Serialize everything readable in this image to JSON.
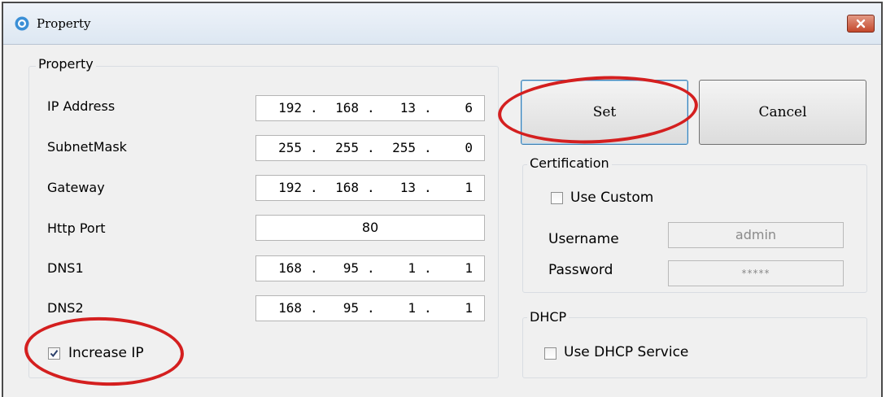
{
  "window": {
    "title": "Property",
    "close_icon": "close-x-icon",
    "app_icon": "app-circle-icon"
  },
  "property_group": {
    "label": "Property",
    "fields": [
      {
        "label": "IP Address",
        "octets": [
          "192",
          "168",
          "13",
          "6"
        ]
      },
      {
        "label": "SubnetMask",
        "octets": [
          "255",
          "255",
          "255",
          "0"
        ]
      },
      {
        "label": "Gateway",
        "octets": [
          "192",
          "168",
          "13",
          "1"
        ]
      },
      {
        "label": "DNS1",
        "octets": [
          "168",
          "95",
          "1",
          "1"
        ]
      },
      {
        "label": "DNS2",
        "octets": [
          "168",
          "95",
          "1",
          "1"
        ]
      }
    ],
    "http_port": {
      "label": "Http Port",
      "value": "80"
    },
    "increase_ip": {
      "label": "Increase IP",
      "checked": true
    }
  },
  "buttons": {
    "set_label": "Set",
    "cancel_label": "Cancel"
  },
  "certification": {
    "label": "Certification",
    "use_custom": {
      "label": "Use Custom",
      "checked": false
    },
    "username": {
      "label": "Username",
      "value": "admin"
    },
    "password": {
      "label": "Password",
      "value": "*****"
    }
  },
  "dhcp": {
    "label": "DHCP",
    "use_dhcp": {
      "label": "Use DHCP Service",
      "checked": false
    }
  },
  "colors": {
    "annotation": "#d41f1f",
    "close_button": "#c4482c"
  }
}
